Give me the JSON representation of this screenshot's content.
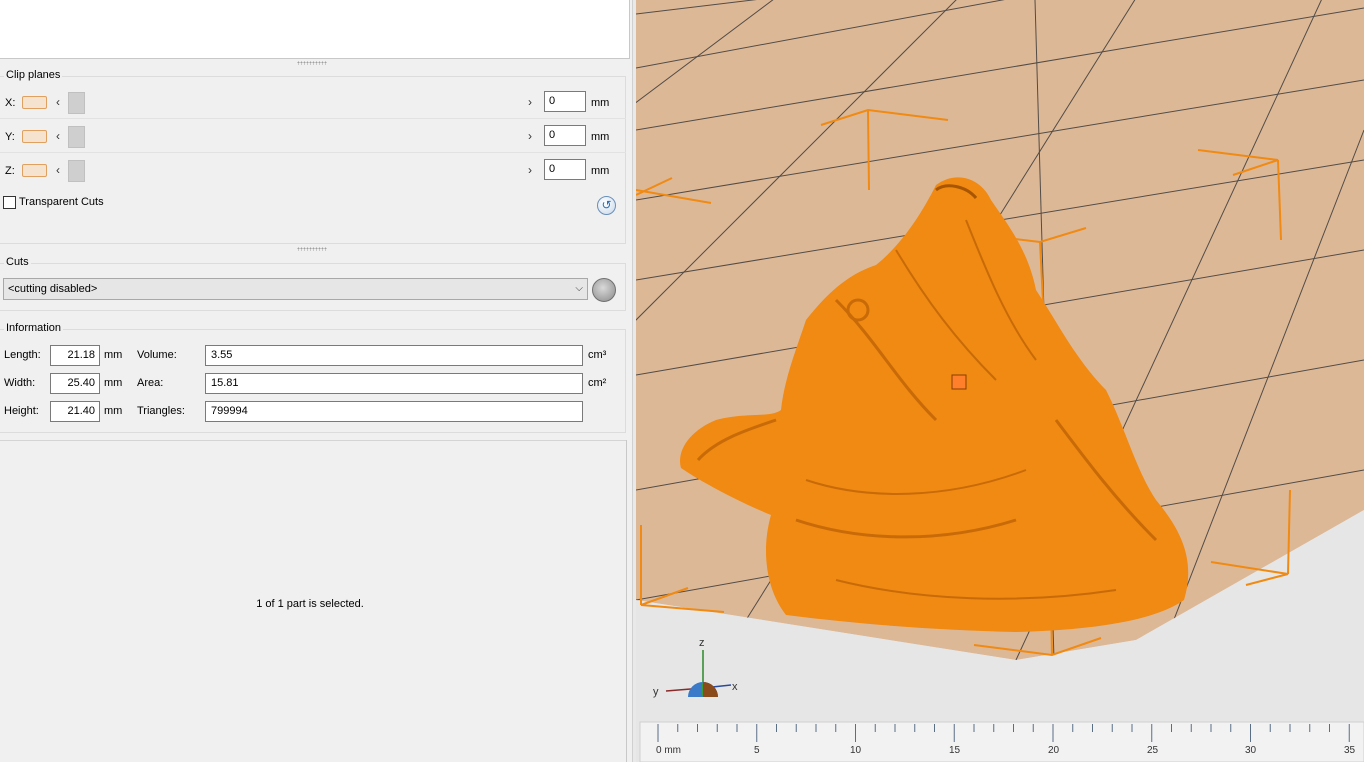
{
  "clip_planes": {
    "title": "Clip planes",
    "unit": "mm",
    "axes": [
      {
        "label": "X:",
        "value": "0"
      },
      {
        "label": "Y:",
        "value": "0"
      },
      {
        "label": "Z:",
        "value": "0"
      }
    ],
    "transparent_cuts_label": "Transparent Cuts",
    "transparent_cuts_checked": false,
    "left_arrow": "‹",
    "right_arrow": "›"
  },
  "cuts": {
    "title": "Cuts",
    "selected": "<cutting disabled>"
  },
  "information": {
    "title": "Information",
    "length_label": "Length:",
    "length_value": "21.18",
    "width_label": "Width:",
    "width_value": "25.40",
    "height_label": "Height:",
    "height_value": "21.40",
    "dim_unit": "mm",
    "volume_label": "Volume:",
    "volume_value": "3.55",
    "volume_unit": "cm³",
    "area_label": "Area:",
    "area_value": "15.81",
    "area_unit": "cm²",
    "triangles_label": "Triangles:",
    "triangles_value": "799994"
  },
  "status_text": "1 of 1 part is selected.",
  "viewport": {
    "model_color": "#f08a12",
    "plate_color": "#ddb896",
    "axis_labels": {
      "z": "z",
      "y": "y",
      "x": "x"
    },
    "ruler": {
      "first_label": "0 mm",
      "labels": [
        "5",
        "10",
        "15",
        "20",
        "25",
        "30",
        "35"
      ]
    }
  }
}
